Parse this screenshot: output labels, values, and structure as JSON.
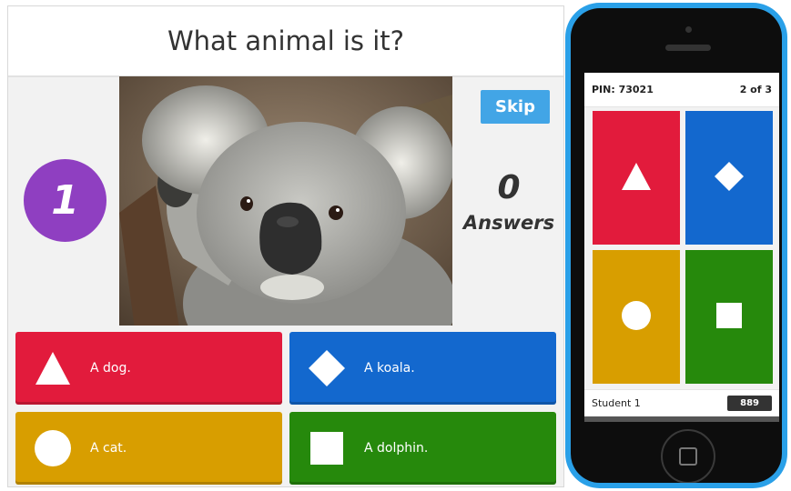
{
  "question": {
    "text": "What animal is it?"
  },
  "timer": {
    "value": "1"
  },
  "skip": {
    "label": "Skip"
  },
  "answers_panel": {
    "count": "0",
    "label": "Answers"
  },
  "image": {
    "subject": "koala"
  },
  "choices": [
    {
      "label": "A dog.",
      "shape": "triangle-icon",
      "color": "#e21b3c"
    },
    {
      "label": "A koala.",
      "shape": "diamond-icon",
      "color": "#1368ce"
    },
    {
      "label": "A cat.",
      "shape": "circle-icon",
      "color": "#d89e00"
    },
    {
      "label": "A dolphin.",
      "shape": "square-icon",
      "color": "#26890c"
    }
  ],
  "phone": {
    "pin": "PIN: 73021",
    "progress": "2 of 3",
    "player": "Student 1",
    "score": "889",
    "frame_color": "#2aa0e8"
  },
  "colors": {
    "timer": "#8f3fc1",
    "skip": "#42a5e6"
  }
}
